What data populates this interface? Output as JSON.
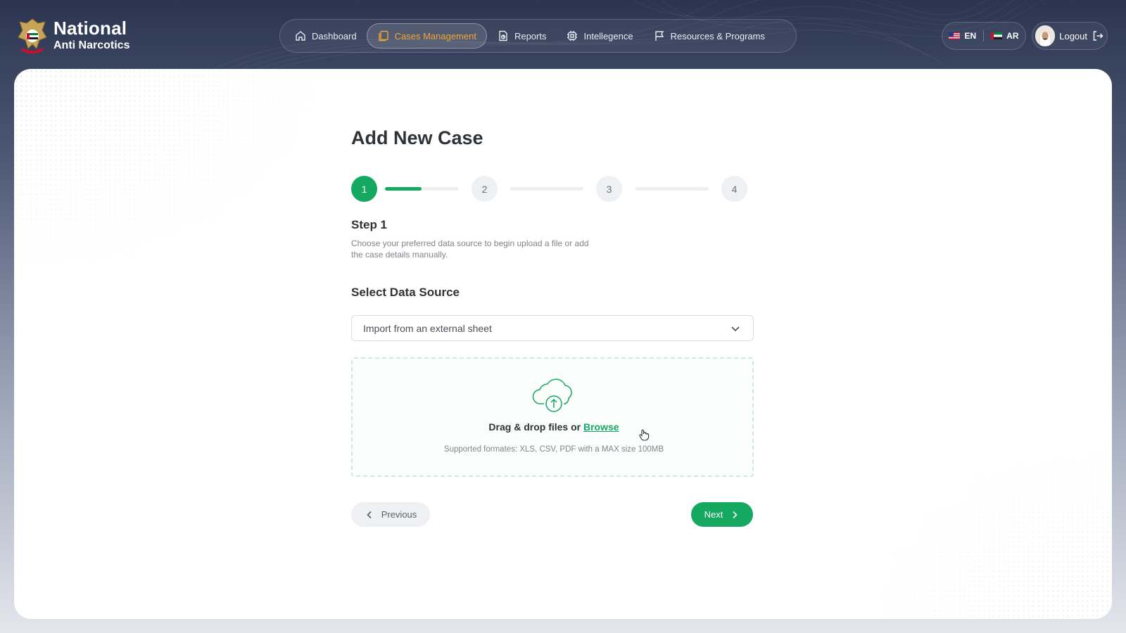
{
  "brand": {
    "line1": "National",
    "line2": "Anti Narcotics"
  },
  "nav": {
    "items": [
      {
        "label": "Dashboard",
        "icon": "home-icon"
      },
      {
        "label": "Cases Management",
        "icon": "copy-icon",
        "active": true
      },
      {
        "label": "Reports",
        "icon": "reports-icon"
      },
      {
        "label": "Intellegence",
        "icon": "chip-icon"
      },
      {
        "label": "Resources & Programs",
        "icon": "flag-icon"
      }
    ]
  },
  "language": {
    "en": "EN",
    "ar": "AR"
  },
  "user": {
    "logout_label": "Logout"
  },
  "page": {
    "title": "Add New Case"
  },
  "stepper": {
    "steps": [
      "1",
      "2",
      "3",
      "4"
    ],
    "current": 1,
    "progress": [
      0.5,
      0,
      0
    ]
  },
  "step": {
    "heading": "Step 1",
    "description": "Choose your preferred data source to begin  upload a file or add the case details manually."
  },
  "data_source": {
    "label": "Select Data Source",
    "selected": "Import from an external sheet"
  },
  "dropzone": {
    "text": "Drag & drop files or",
    "browse": "Browse",
    "supported": "Supported formates:  XLS, CSV, PDF with a MAX size 100MB"
  },
  "actions": {
    "previous": "Previous",
    "next": "Next"
  },
  "colors": {
    "accent": "#14a861",
    "active_nav": "#f0a830",
    "header_bg": "#2b3550"
  }
}
